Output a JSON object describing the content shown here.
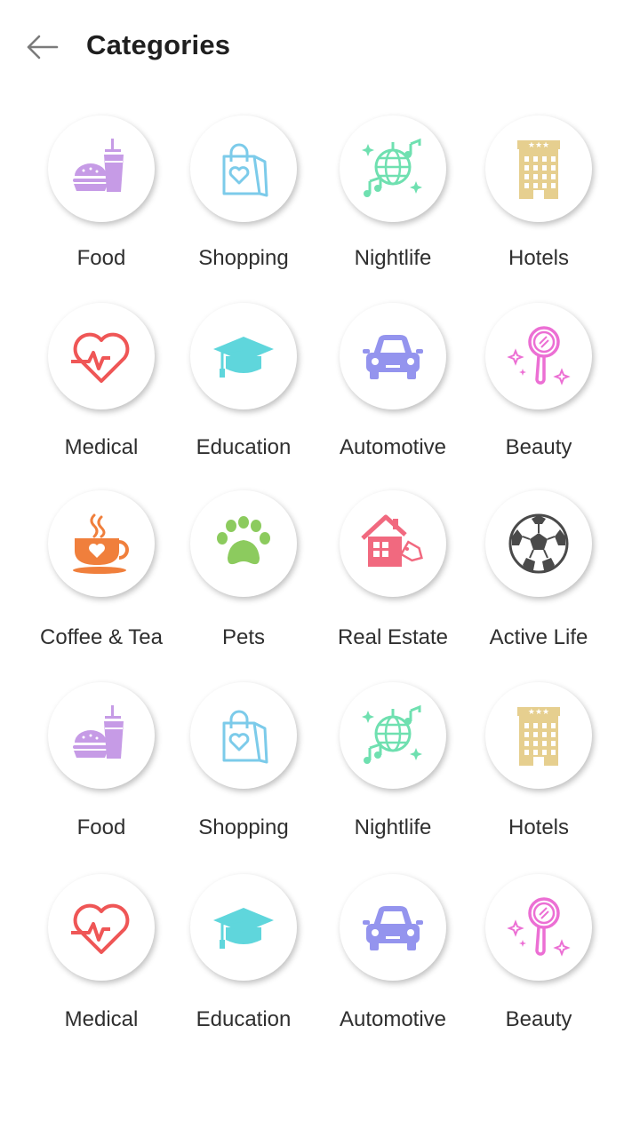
{
  "header": {
    "title": "Categories",
    "back_icon": "arrow-left-icon"
  },
  "categories": [
    {
      "id": "food",
      "label": "Food",
      "icon": "food-icon",
      "color": "#c69be6"
    },
    {
      "id": "shopping",
      "label": "Shopping",
      "icon": "shopping-bag-icon",
      "color": "#7ccbea"
    },
    {
      "id": "nightlife",
      "label": "Nightlife",
      "icon": "disco-ball-icon",
      "color": "#6fe0b0"
    },
    {
      "id": "hotels",
      "label": "Hotels",
      "icon": "hotel-icon",
      "color": "#e6cf8f"
    },
    {
      "id": "medical",
      "label": "Medical",
      "icon": "heartbeat-icon",
      "color": "#ef5656"
    },
    {
      "id": "education",
      "label": "Education",
      "icon": "graduation-cap-icon",
      "color": "#5fd6dc"
    },
    {
      "id": "automotive",
      "label": "Automotive",
      "icon": "car-icon",
      "color": "#9494ee"
    },
    {
      "id": "beauty",
      "label": "Beauty",
      "icon": "hand-mirror-icon",
      "color": "#ec6fd4"
    },
    {
      "id": "coffee",
      "label": "Coffee & Tea",
      "icon": "coffee-cup-icon",
      "color": "#f07f3c"
    },
    {
      "id": "pets",
      "label": "Pets",
      "icon": "paw-icon",
      "color": "#8ccb5e"
    },
    {
      "id": "realestate",
      "label": "Real Estate",
      "icon": "house-tag-icon",
      "color": "#f1697f"
    },
    {
      "id": "activelife",
      "label": "Active Life",
      "icon": "soccer-ball-icon",
      "color": "#4a4a4a"
    },
    {
      "id": "food",
      "label": "Food",
      "icon": "food-icon",
      "color": "#c69be6"
    },
    {
      "id": "shopping",
      "label": "Shopping",
      "icon": "shopping-bag-icon",
      "color": "#7ccbea"
    },
    {
      "id": "nightlife",
      "label": "Nightlife",
      "icon": "disco-ball-icon",
      "color": "#6fe0b0"
    },
    {
      "id": "hotels",
      "label": "Hotels",
      "icon": "hotel-icon",
      "color": "#e6cf8f"
    },
    {
      "id": "medical",
      "label": "Medical",
      "icon": "heartbeat-icon",
      "color": "#ef5656"
    },
    {
      "id": "education",
      "label": "Education",
      "icon": "graduation-cap-icon",
      "color": "#5fd6dc"
    },
    {
      "id": "automotive",
      "label": "Automotive",
      "icon": "car-icon",
      "color": "#9494ee"
    },
    {
      "id": "beauty",
      "label": "Beauty",
      "icon": "hand-mirror-icon",
      "color": "#ec6fd4"
    }
  ]
}
